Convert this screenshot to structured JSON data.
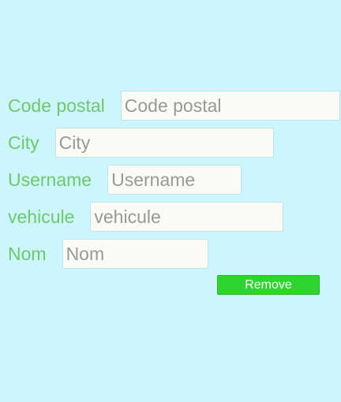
{
  "form": {
    "fields": [
      {
        "label": "Code postal",
        "placeholder": "Code postal",
        "value": ""
      },
      {
        "label": "City",
        "placeholder": "City",
        "value": ""
      },
      {
        "label": "Username",
        "placeholder": "Username",
        "value": ""
      },
      {
        "label": "vehicule",
        "placeholder": "vehicule",
        "value": ""
      },
      {
        "label": "Nom",
        "placeholder": "Nom",
        "value": ""
      }
    ],
    "remove_label": "Remove"
  },
  "colors": {
    "background": "#ccf6fc",
    "label_text": "#6fc86f",
    "field_background": "#fafaf7",
    "placeholder_text": "#999999",
    "button_background": "#2ed52e",
    "button_text": "#ffffff"
  }
}
